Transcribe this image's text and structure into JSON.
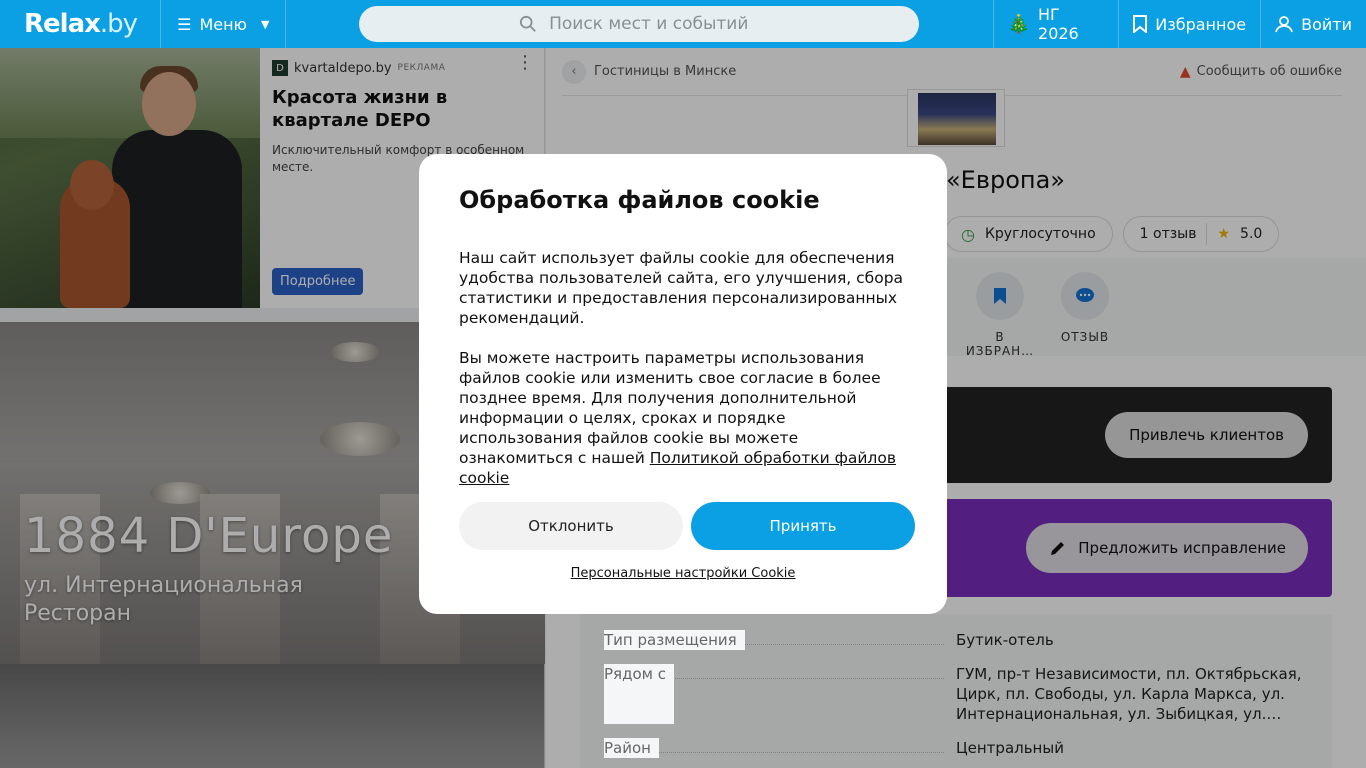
{
  "header": {
    "logo": "Relax",
    "logo_suffix": ".by",
    "menu_label": "Меню",
    "search_placeholder": "Поиск мест и событий",
    "ny_label": "НГ 2026",
    "favorites_label": "Избранное",
    "login_label": "Войти"
  },
  "ad": {
    "source": "kvartaldepo.by",
    "tag": "РЕКЛАМА",
    "title": "Красота жизни в квартале DEPO",
    "text": "Исключительный комфорт в особенном месте.",
    "button": "Подробнее"
  },
  "hero": {
    "name": "1884 D'Europe",
    "address": "ул. Интернациональная",
    "category": "Ресторан"
  },
  "place": {
    "breadcrumb": "Гостиницы в Минске",
    "report": "Сообщить об ошибке",
    "title_visible": "«Европа»",
    "hours": "Круглосуточно",
    "reviews": "1 отзыв",
    "rating": "5.0",
    "actions": [
      "В ИЗБРАН…",
      "ОТЗЫВ"
    ],
    "promo_button": "Привлечь клиентов",
    "suggest_button": "Предложить исправление",
    "info": [
      {
        "k": "Тип размещения",
        "v": "Бутик-отель"
      },
      {
        "k": "Рядом с",
        "v": "ГУМ, пр-т Независимости, пл. Октябрьская, Цирк, пл. Свободы, ул. Карла Маркса, ул. Интернациональная, ул. Зыбицкая, ул.…"
      },
      {
        "k": "Район",
        "v": "Центральный"
      }
    ]
  },
  "cookie": {
    "title": "Обработка файлов cookie",
    "para1": "Наш сайт использует файлы cookie для обеспечения удобства пользователей сайта, его улучшения, сбора статистики и предоставления персонализированных рекомендаций.",
    "para2": "Вы можете настроить параметры использования файлов cookie или изменить свое согласие в более позднее время. Для получения дополнительной информации о целях, сроках и порядке использования файлов cookie вы можете ознакомиться с нашей",
    "policy_link": "Политикой обработки файлов cookie",
    "decline": "Отклонить",
    "accept": "Принять",
    "personal": "Персональные настройки Cookie"
  },
  "colors": {
    "brand": "#0aa0e3",
    "promo_purple": "#7a2fbd",
    "ad_button": "#2a60c8"
  }
}
